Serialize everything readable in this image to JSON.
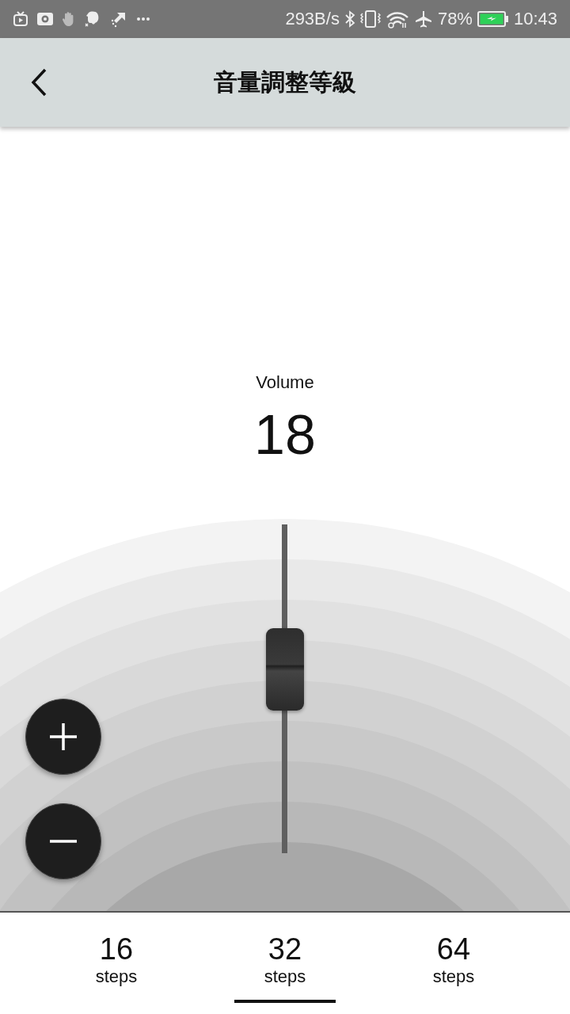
{
  "status_bar": {
    "network_speed": "293B/s",
    "battery": "78%",
    "time": "10:43"
  },
  "app_bar": {
    "title": "音量調整等級"
  },
  "volume": {
    "label": "Volume",
    "value": "18",
    "level": 0.58
  },
  "step_tabs": [
    {
      "value": "16",
      "unit": "steps",
      "selected": false
    },
    {
      "value": "32",
      "unit": "steps",
      "selected": true
    },
    {
      "value": "64",
      "unit": "steps",
      "selected": false
    }
  ]
}
